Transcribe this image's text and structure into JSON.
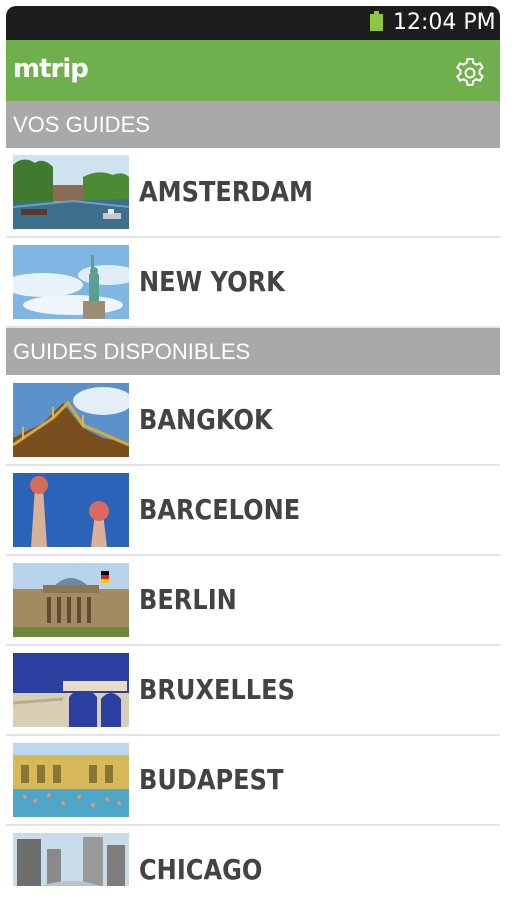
{
  "status_bar": {
    "time": "12:04 PM",
    "battery_icon": "battery-icon"
  },
  "app_bar": {
    "title": "mtrip",
    "settings_icon": "gear-icon",
    "color": "#6faf4d"
  },
  "sections": {
    "my_guides": {
      "title": "VOS GUIDES",
      "items": [
        {
          "city": "AMSTERDAM",
          "image": "amsterdam-canal-photo"
        },
        {
          "city": "NEW YORK",
          "image": "statue-of-liberty-photo"
        }
      ]
    },
    "available_guides": {
      "title": "GUIDES DISPONIBLES",
      "items": [
        {
          "city": "BANGKOK",
          "image": "thai-temple-roof-photo"
        },
        {
          "city": "BARCELONE",
          "image": "gaudi-spires-photo"
        },
        {
          "city": "BERLIN",
          "image": "reichstag-photo"
        },
        {
          "city": "BRUXELLES",
          "image": "cinquantenaire-arch-photo"
        },
        {
          "city": "BUDAPEST",
          "image": "szechenyi-baths-photo"
        },
        {
          "city": "CHICAGO",
          "image": "chicago-bean-photo"
        }
      ]
    }
  },
  "colors": {
    "section_header": "#a9a9a9",
    "status_bar": "#1d1d1d",
    "city_text": "#434343"
  }
}
